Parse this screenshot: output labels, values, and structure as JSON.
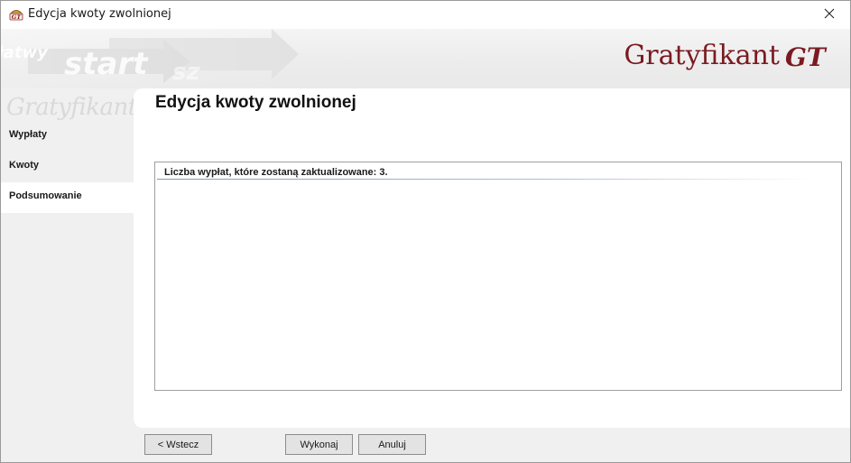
{
  "window": {
    "title": "Edycja kwoty zwolnionej",
    "icon": "gratyfikant-app-icon"
  },
  "titlebar_buttons": {
    "close_icon": "close-icon"
  },
  "banner": {
    "brand_name": "Gratyfikant",
    "brand_mark": "GT",
    "brand_color": "#7b1a21"
  },
  "nav": {
    "items": [
      {
        "label": "Wypłaty",
        "active": false
      },
      {
        "label": "Kwoty",
        "active": false
      },
      {
        "label": "Podsumowanie",
        "active": true
      }
    ]
  },
  "main": {
    "title": "Edycja kwoty zwolnionej",
    "summary_text": "Liczba wypłat, które zostaną zaktualizowane: 3."
  },
  "buttons": {
    "back_label": "< Wstecz",
    "execute_label": "Wykonaj",
    "cancel_label": "Anuluj"
  }
}
